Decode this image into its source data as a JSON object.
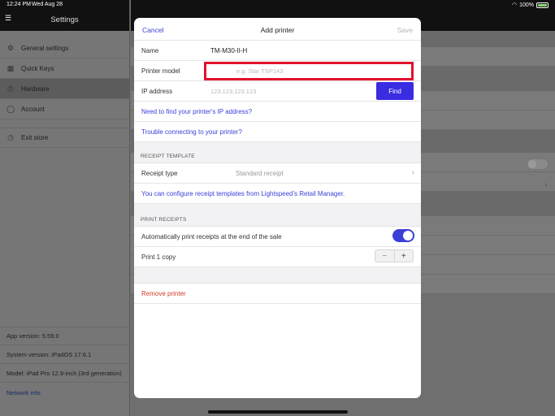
{
  "statusbar": {
    "time": "12:24 PM",
    "date": "Wed Aug 28",
    "battery": "100%"
  },
  "sidebar": {
    "title": "Settings",
    "items": [
      {
        "label": "General settings",
        "icon": "gear-icon",
        "glyph": "⚙"
      },
      {
        "label": "Quick Keys",
        "icon": "grid-icon",
        "glyph": "▦"
      },
      {
        "label": "Hardware",
        "icon": "printer-icon",
        "glyph": "⎙"
      },
      {
        "label": "Account",
        "icon": "user-icon",
        "glyph": "◯"
      },
      {
        "label": "Exit store",
        "icon": "clock-icon",
        "glyph": "◷"
      }
    ],
    "info": {
      "app_version": "App version: 5.59.0",
      "system_version": "System version: iPadOS 17.6.1",
      "model": "Model: iPad Pro 12.9-inch (3rd generation)",
      "network": "Network info"
    }
  },
  "modal": {
    "cancel": "Cancel",
    "title": "Add printer",
    "save": "Save",
    "name_label": "Name",
    "name_value": "TM-M30-II-H",
    "model_label": "Printer model",
    "model_placeholder": "e.g. Star TSP143",
    "ip_label": "IP address",
    "ip_placeholder": "123.123.123.123",
    "find": "Find",
    "find_ip_link": "Need to find your printer's IP address?",
    "trouble_link": "Trouble connecting to your printer?",
    "receipt_section": "RECEIPT TEMPLATE",
    "receipt_type_label": "Receipt type",
    "receipt_type_value": "Standard receipt",
    "configure_link": "You can configure receipt templates from Lightspeed's Retail Manager.",
    "print_section": "PRINT RECEIPTS",
    "auto_print_label": "Automatically print receipts at the end of the sale",
    "auto_print_on": true,
    "print_copy_label": "Print 1 copy",
    "minus": "−",
    "plus": "+",
    "remove": "Remove printer"
  },
  "colors": {
    "accent": "#3a3fd8",
    "find_button": "#3a2ce0",
    "highlight": "#e1122c",
    "danger": "#d33a2a"
  }
}
